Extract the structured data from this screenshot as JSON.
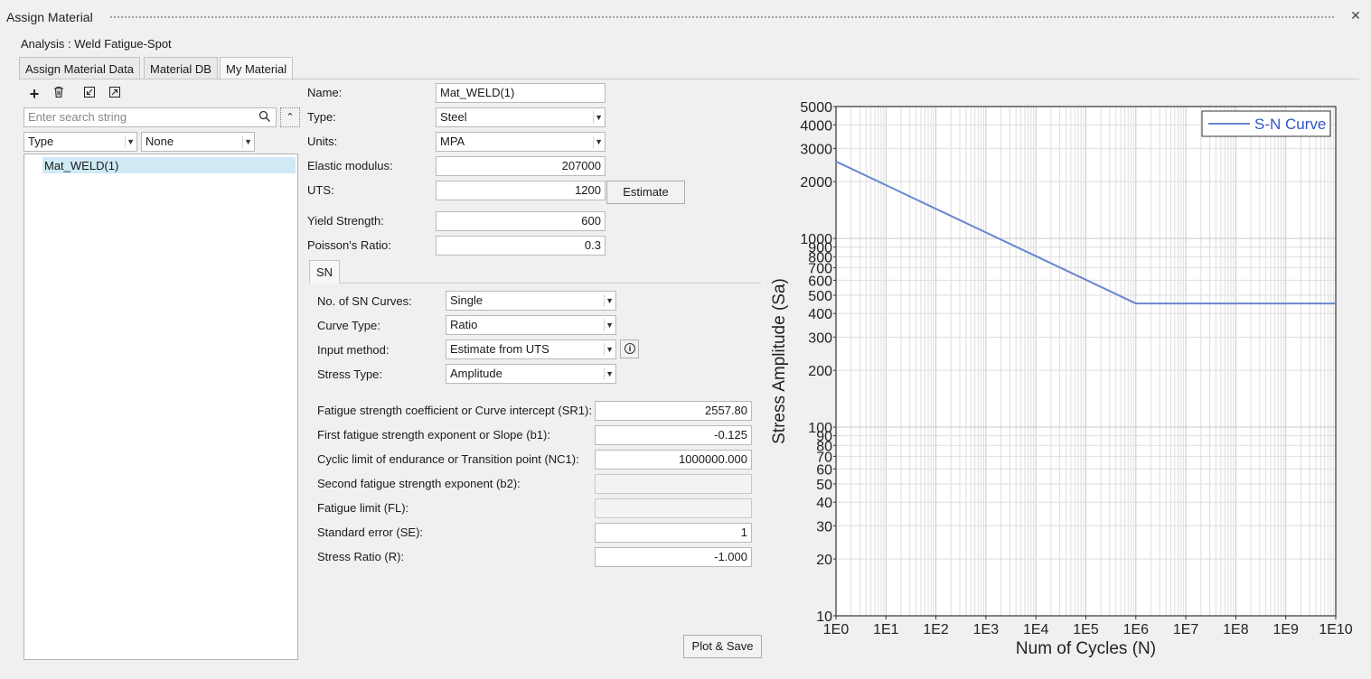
{
  "window": {
    "title": "Assign Material"
  },
  "analysis_label": "Analysis : Weld Fatigue-Spot",
  "tabs": [
    {
      "label": "Assign Material Data"
    },
    {
      "label": "Material DB"
    },
    {
      "label": "My Material"
    }
  ],
  "toolbar": {
    "icons": [
      "add-icon",
      "delete-icon",
      "import-icon",
      "export-icon"
    ]
  },
  "search": {
    "placeholder": "Enter search string"
  },
  "filters": {
    "type": "Type",
    "value": "None"
  },
  "materials": [
    {
      "name": "Mat_WELD(1)"
    }
  ],
  "props": {
    "name_label": "Name:",
    "name": "Mat_WELD(1)",
    "type_label": "Type:",
    "type": "Steel",
    "units_label": "Units:",
    "units": "MPA",
    "elastic_label": "Elastic modulus:",
    "elastic": "207000",
    "uts_label": "UTS:",
    "uts": "1200",
    "estimate_label": "Estimate",
    "yield_label": "Yield Strength:",
    "yield": "600",
    "poisson_label": "Poisson's Ratio:",
    "poisson": "0.3"
  },
  "sn": {
    "tab_label": "SN",
    "num_curves_label": "No. of SN Curves:",
    "num_curves": "Single",
    "curve_type_label": "Curve Type:",
    "curve_type": "Ratio",
    "input_method_label": "Input method:",
    "input_method": "Estimate from UTS",
    "stress_type_label": "Stress Type:",
    "stress_type": "Amplitude",
    "sr1_label": "Fatigue strength coefficient or Curve intercept (SR1):",
    "sr1": "2557.80",
    "b1_label": "First fatigue strength exponent or Slope (b1):",
    "b1": "-0.125",
    "nc1_label": "Cyclic limit of endurance or Transition point (NC1):",
    "nc1": "1000000.000",
    "b2_label": "Second fatigue strength exponent (b2):",
    "b2": "",
    "fl_label": "Fatigue limit (FL):",
    "fl": "",
    "se_label": "Standard error (SE):",
    "se": "1",
    "r_label": "Stress Ratio (R):",
    "r": "-1.000"
  },
  "plot_save_label": "Plot & Save",
  "chart_data": {
    "type": "line",
    "xlabel": "Num of Cycles (N)",
    "ylabel": "Stress Amplitude (Sa)",
    "xscale": "log",
    "yscale": "log",
    "xlim": [
      1,
      10000000000
    ],
    "ylim": [
      10,
      5000
    ],
    "x_tick_labels": [
      "1E0",
      "1E1",
      "1E2",
      "1E3",
      "1E4",
      "1E5",
      "1E6",
      "1E7",
      "1E8",
      "1E9",
      "1E10"
    ],
    "y_tick_labels": [
      "10",
      "20",
      "30",
      "40",
      "50",
      "60",
      "70",
      "80",
      "90",
      "100",
      "200",
      "300",
      "400",
      "500",
      "600",
      "700",
      "800",
      "900",
      "1000",
      "2000",
      "3000",
      "4000",
      "5000"
    ],
    "grid": true,
    "legend_position": "top-right",
    "series": [
      {
        "name": "S-N Curve",
        "color": "#6a86d0",
        "x": [
          1,
          1000000,
          10000000000
        ],
        "y": [
          2557.8,
          452.2,
          452.2
        ]
      }
    ]
  }
}
